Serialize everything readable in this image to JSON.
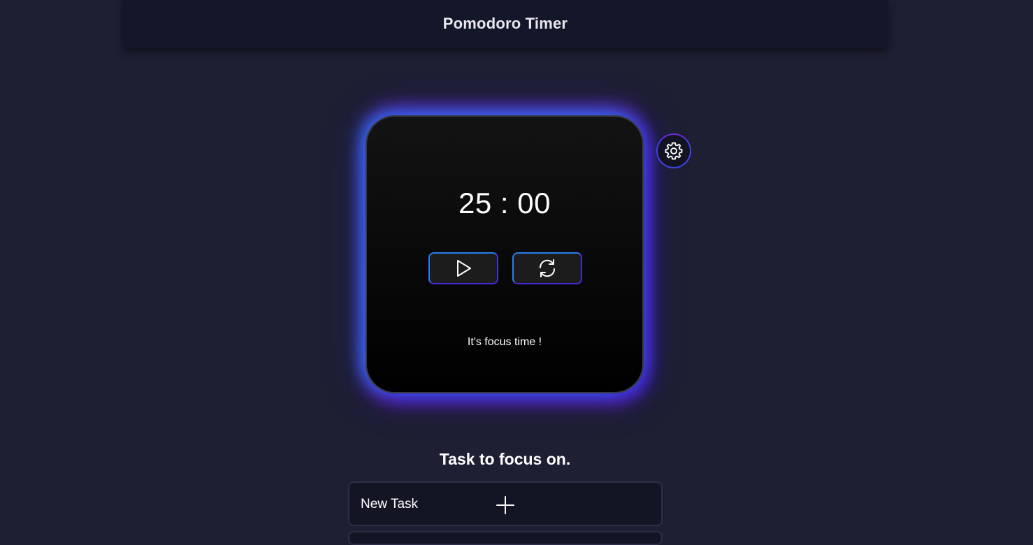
{
  "header": {
    "title": "Pomodoro Timer"
  },
  "timer": {
    "minutes": "25",
    "separator": ":",
    "seconds": "00",
    "display": "25 : 00",
    "status": "It's focus time !",
    "controls": {
      "play_icon": "play-icon",
      "reset_icon": "refresh-icon"
    }
  },
  "settings": {
    "icon": "gear-icon"
  },
  "tasks": {
    "heading": "Task to focus on.",
    "new_task_label": "New Task",
    "add_icon": "plus-icon"
  },
  "colors": {
    "background": "#1e1f33",
    "header_bg": "#141629",
    "card_glow_blue": "#1f8aff",
    "card_glow_purple": "#8c19dc",
    "button_border": "#2a7df0"
  }
}
